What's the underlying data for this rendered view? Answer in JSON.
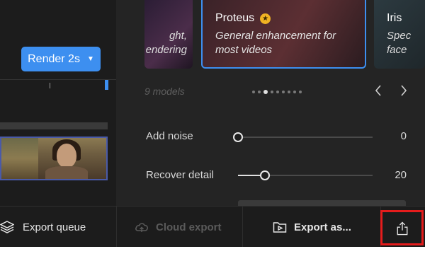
{
  "left": {
    "render_button": "Render 2s"
  },
  "cards": {
    "left_desc_lines": [
      "ght,",
      "endering"
    ],
    "selected": {
      "title": "Proteus",
      "desc_line1": "General enhancement for",
      "desc_line2": "most videos"
    },
    "right": {
      "title": "Iris",
      "desc_line1": "Spec",
      "desc_line2": "face"
    }
  },
  "carousel": {
    "models_count": "9 models",
    "dots": 9,
    "active_dot": 2
  },
  "params": [
    {
      "label": "Add noise",
      "value": "0",
      "fraction": 0.0
    },
    {
      "label": "Recover detail",
      "value": "20",
      "fraction": 0.2
    }
  ],
  "bottom_bar": {
    "export_queue": "Export queue",
    "cloud_export": "Cloud export",
    "export_as": "Export as..."
  },
  "colors": {
    "accent": "#3d8ff0",
    "highlight": "#e51c1c",
    "star": "#f0b323"
  }
}
